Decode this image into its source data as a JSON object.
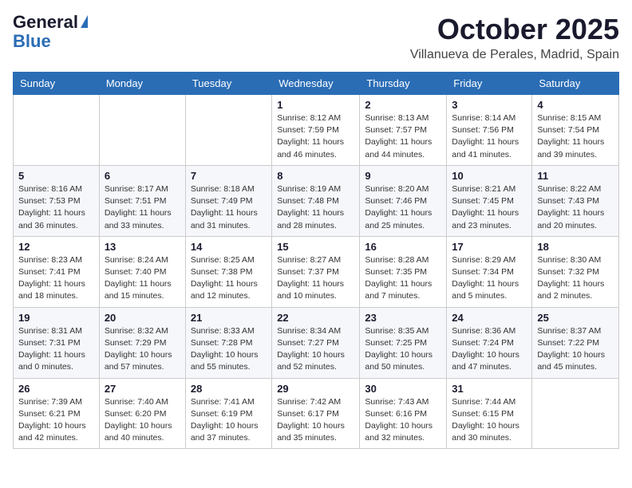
{
  "logo": {
    "general": "General",
    "blue": "Blue",
    "icon": "▶"
  },
  "title": {
    "month": "October 2025",
    "location": "Villanueva de Perales, Madrid, Spain"
  },
  "weekdays": [
    "Sunday",
    "Monday",
    "Tuesday",
    "Wednesday",
    "Thursday",
    "Friday",
    "Saturday"
  ],
  "weeks": [
    [
      {
        "day": "",
        "info": ""
      },
      {
        "day": "",
        "info": ""
      },
      {
        "day": "",
        "info": ""
      },
      {
        "day": "1",
        "info": "Sunrise: 8:12 AM\nSunset: 7:59 PM\nDaylight: 11 hours and 46 minutes."
      },
      {
        "day": "2",
        "info": "Sunrise: 8:13 AM\nSunset: 7:57 PM\nDaylight: 11 hours and 44 minutes."
      },
      {
        "day": "3",
        "info": "Sunrise: 8:14 AM\nSunset: 7:56 PM\nDaylight: 11 hours and 41 minutes."
      },
      {
        "day": "4",
        "info": "Sunrise: 8:15 AM\nSunset: 7:54 PM\nDaylight: 11 hours and 39 minutes."
      }
    ],
    [
      {
        "day": "5",
        "info": "Sunrise: 8:16 AM\nSunset: 7:53 PM\nDaylight: 11 hours and 36 minutes."
      },
      {
        "day": "6",
        "info": "Sunrise: 8:17 AM\nSunset: 7:51 PM\nDaylight: 11 hours and 33 minutes."
      },
      {
        "day": "7",
        "info": "Sunrise: 8:18 AM\nSunset: 7:49 PM\nDaylight: 11 hours and 31 minutes."
      },
      {
        "day": "8",
        "info": "Sunrise: 8:19 AM\nSunset: 7:48 PM\nDaylight: 11 hours and 28 minutes."
      },
      {
        "day": "9",
        "info": "Sunrise: 8:20 AM\nSunset: 7:46 PM\nDaylight: 11 hours and 25 minutes."
      },
      {
        "day": "10",
        "info": "Sunrise: 8:21 AM\nSunset: 7:45 PM\nDaylight: 11 hours and 23 minutes."
      },
      {
        "day": "11",
        "info": "Sunrise: 8:22 AM\nSunset: 7:43 PM\nDaylight: 11 hours and 20 minutes."
      }
    ],
    [
      {
        "day": "12",
        "info": "Sunrise: 8:23 AM\nSunset: 7:41 PM\nDaylight: 11 hours and 18 minutes."
      },
      {
        "day": "13",
        "info": "Sunrise: 8:24 AM\nSunset: 7:40 PM\nDaylight: 11 hours and 15 minutes."
      },
      {
        "day": "14",
        "info": "Sunrise: 8:25 AM\nSunset: 7:38 PM\nDaylight: 11 hours and 12 minutes."
      },
      {
        "day": "15",
        "info": "Sunrise: 8:27 AM\nSunset: 7:37 PM\nDaylight: 11 hours and 10 minutes."
      },
      {
        "day": "16",
        "info": "Sunrise: 8:28 AM\nSunset: 7:35 PM\nDaylight: 11 hours and 7 minutes."
      },
      {
        "day": "17",
        "info": "Sunrise: 8:29 AM\nSunset: 7:34 PM\nDaylight: 11 hours and 5 minutes."
      },
      {
        "day": "18",
        "info": "Sunrise: 8:30 AM\nSunset: 7:32 PM\nDaylight: 11 hours and 2 minutes."
      }
    ],
    [
      {
        "day": "19",
        "info": "Sunrise: 8:31 AM\nSunset: 7:31 PM\nDaylight: 11 hours and 0 minutes."
      },
      {
        "day": "20",
        "info": "Sunrise: 8:32 AM\nSunset: 7:29 PM\nDaylight: 10 hours and 57 minutes."
      },
      {
        "day": "21",
        "info": "Sunrise: 8:33 AM\nSunset: 7:28 PM\nDaylight: 10 hours and 55 minutes."
      },
      {
        "day": "22",
        "info": "Sunrise: 8:34 AM\nSunset: 7:27 PM\nDaylight: 10 hours and 52 minutes."
      },
      {
        "day": "23",
        "info": "Sunrise: 8:35 AM\nSunset: 7:25 PM\nDaylight: 10 hours and 50 minutes."
      },
      {
        "day": "24",
        "info": "Sunrise: 8:36 AM\nSunset: 7:24 PM\nDaylight: 10 hours and 47 minutes."
      },
      {
        "day": "25",
        "info": "Sunrise: 8:37 AM\nSunset: 7:22 PM\nDaylight: 10 hours and 45 minutes."
      }
    ],
    [
      {
        "day": "26",
        "info": "Sunrise: 7:39 AM\nSunset: 6:21 PM\nDaylight: 10 hours and 42 minutes."
      },
      {
        "day": "27",
        "info": "Sunrise: 7:40 AM\nSunset: 6:20 PM\nDaylight: 10 hours and 40 minutes."
      },
      {
        "day": "28",
        "info": "Sunrise: 7:41 AM\nSunset: 6:19 PM\nDaylight: 10 hours and 37 minutes."
      },
      {
        "day": "29",
        "info": "Sunrise: 7:42 AM\nSunset: 6:17 PM\nDaylight: 10 hours and 35 minutes."
      },
      {
        "day": "30",
        "info": "Sunrise: 7:43 AM\nSunset: 6:16 PM\nDaylight: 10 hours and 32 minutes."
      },
      {
        "day": "31",
        "info": "Sunrise: 7:44 AM\nSunset: 6:15 PM\nDaylight: 10 hours and 30 minutes."
      },
      {
        "day": "",
        "info": ""
      }
    ]
  ]
}
